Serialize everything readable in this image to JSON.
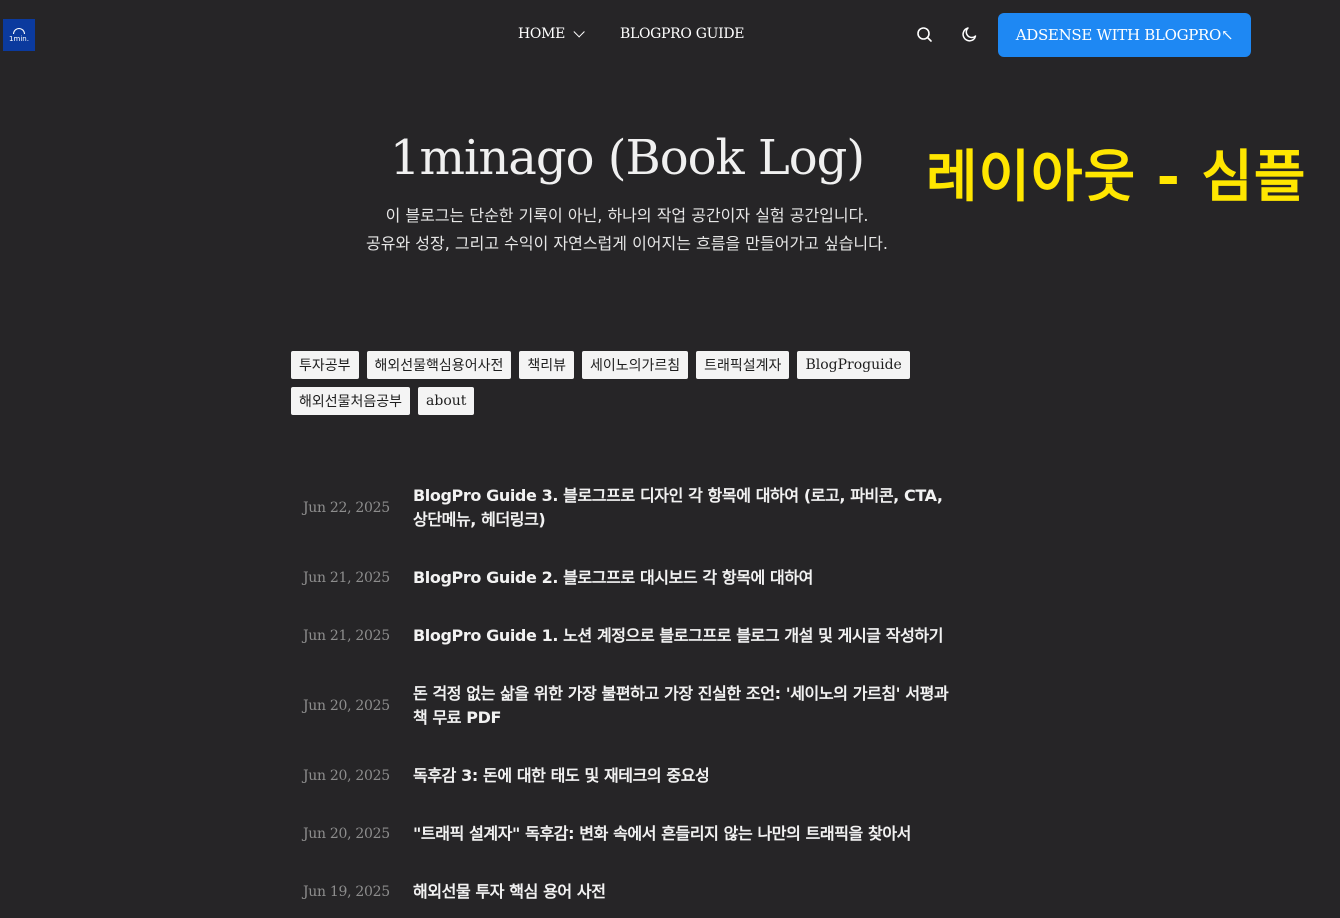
{
  "logo": {
    "text": "1min."
  },
  "nav": {
    "home": "HOME",
    "guide": "BLOGPRO GUIDE",
    "cta": "ADSENSE WITH BLOGPRO↖"
  },
  "icons": {
    "search": "search-icon",
    "theme": "moon-icon",
    "menu": "chevron-down-icon"
  },
  "colors": {
    "background": "#262527",
    "cta": "#1e88f3",
    "overlay": "#ffe600"
  },
  "hero": {
    "title": "1minago (Book Log)",
    "overlay": "레이아웃 - 심플",
    "desc1": "이 블로그는 단순한 기록이 아닌, 하나의 작업 공간이자 실험 공간입니다.",
    "desc2": "공유와 성장, 그리고 수익이 자연스럽게 이어지는 흐름을 만들어가고 싶습니다."
  },
  "tags": [
    "투자공부",
    "해외선물핵심용어사전",
    "책리뷰",
    "세이노의가르침",
    "트래픽설계자",
    "BlogProguide",
    "해외선물처음공부",
    "about"
  ],
  "posts": [
    {
      "date": "Jun 22, 2025",
      "title": "BlogPro Guide 3. 블로그프로 디자인 각 항목에 대하여 (로고, 파비콘, CTA, 상단메뉴, 헤더링크)"
    },
    {
      "date": "Jun 21, 2025",
      "title": "BlogPro Guide 2. 블로그프로 대시보드 각 항목에 대하여"
    },
    {
      "date": "Jun 21, 2025",
      "title": "BlogPro Guide 1. 노션 계정으로 블로그프로 블로그 개설 및 게시글 작성하기"
    },
    {
      "date": "Jun 20, 2025",
      "title": "돈 걱정 없는 삶을 위한 가장 불편하고 가장 진실한 조언: '세이노의 가르침' 서평과 책 무료 PDF"
    },
    {
      "date": "Jun 20, 2025",
      "title": "독후감 3: 돈에 대한 태도 및 재테크의 중요성"
    },
    {
      "date": "Jun 20, 2025",
      "title": "\"트래픽 설계자\" 독후감: 변화 속에서 흔들리지 않는 나만의 트래픽을 찾아서"
    },
    {
      "date": "Jun 19, 2025",
      "title": "해외선물 투자 핵심 용어 사전"
    }
  ]
}
